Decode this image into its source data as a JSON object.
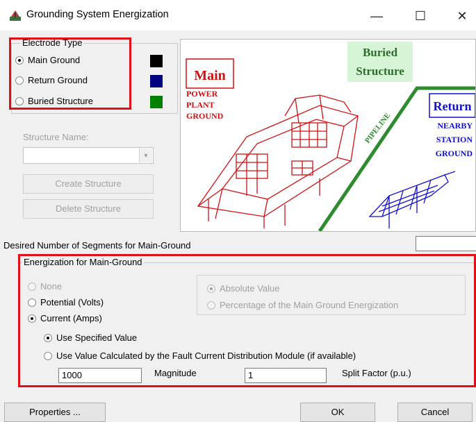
{
  "window": {
    "title": "Grounding System Energization",
    "controls": {
      "minimize": "—",
      "maximize": "☐",
      "close": "✕"
    }
  },
  "electrode_type": {
    "legend": "Electrode Type",
    "options": [
      {
        "label": "Main Ground",
        "selected": true,
        "color": "#000000"
      },
      {
        "label": "Return Ground",
        "selected": false,
        "color": "#000080"
      },
      {
        "label": "Buried Structure",
        "selected": false,
        "color": "#008000"
      }
    ]
  },
  "structure": {
    "name_label": "Structure Name:",
    "name_value": "",
    "create_button": "Create Structure",
    "delete_button": "Delete Structure"
  },
  "diagram": {
    "main_title": "Main",
    "main_caption": [
      "POWER",
      "PLANT",
      "GROUND"
    ],
    "buried_title": [
      "Buried",
      "Structure"
    ],
    "pipeline_label": "PIPELINE",
    "return_title": "Return",
    "return_caption": [
      "NEARBY",
      "STATION",
      "GROUND"
    ],
    "colors": {
      "main": "#d01010",
      "buried": "#2e8b2e",
      "return": "#1010d0"
    }
  },
  "segments": {
    "label": "Desired Number of Segments for Main-Ground",
    "value": ""
  },
  "energization": {
    "legend": "Energization for Main-Ground",
    "modes": [
      {
        "label": "None",
        "selected": false,
        "enabled": false
      },
      {
        "label": "Potential (Volts)",
        "selected": false,
        "enabled": true
      },
      {
        "label": "Current (Amps)",
        "selected": true,
        "enabled": true
      }
    ],
    "value_type": [
      {
        "label": "Absolute Value",
        "selected": true,
        "enabled": false
      },
      {
        "label": "Percentage of the Main Ground Energization",
        "selected": false,
        "enabled": false
      }
    ],
    "current_source": [
      {
        "label": "Use Specified Value",
        "selected": true
      },
      {
        "label": "Use Value Calculated by the Fault Current Distribution Module (if available)",
        "selected": false
      }
    ],
    "magnitude_value": "1000",
    "magnitude_label": "Magnitude",
    "split_factor_value": "1",
    "split_factor_label": "Split Factor (p.u.)"
  },
  "footer": {
    "properties_button": "Properties ...",
    "ok_button": "OK",
    "cancel_button": "Cancel"
  }
}
